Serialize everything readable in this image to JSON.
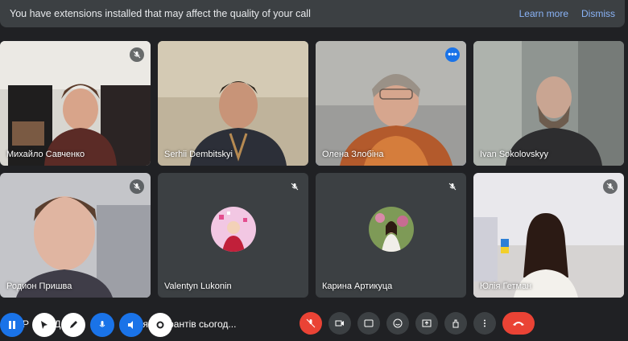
{
  "banner": {
    "text": "You have extensions installed that may affect the quality of your call",
    "learn_more": "Learn more",
    "dismiss": "Dismiss"
  },
  "participants": [
    {
      "name": "Михайло Савченко"
    },
    {
      "name": "Serhii Dembitskyi"
    },
    {
      "name": "Олена Злобіна"
    },
    {
      "name": "Ivan Sokolovskyy"
    },
    {
      "name": "Родион Пришва"
    },
    {
      "name": "Valentyn Lukonin"
    },
    {
      "name": "Карина Артикуца"
    },
    {
      "name": "Юлія Гетман"
    }
  ],
  "meeting": {
    "title_fragments": [
      "Р",
      "Д",
      "м",
      "ля аспірантів сьогод..."
    ]
  },
  "colors": {
    "accent": "#8ab4f8",
    "danger": "#ea4335",
    "overlay_blue": "#1a73e8"
  }
}
